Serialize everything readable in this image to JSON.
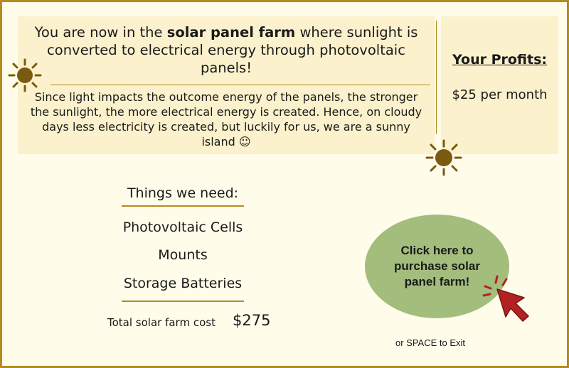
{
  "intro": {
    "prefix": "You are now in the ",
    "highlight": "solar panel farm",
    "suffix": " where sunlight is converted to electrical energy through photovoltaic panels!"
  },
  "detail": "Since light impacts the outcome energy of the panels, the stronger the sunlight, the more electrical energy is created. Hence, on cloudy days less electricity is created, but luckily for us, we are a sunny island ☺",
  "profits": {
    "title": "Your Profits:",
    "value": "$25 per month"
  },
  "needs": {
    "title": "Things we need:",
    "items": [
      "Photovoltaic Cells",
      "Mounts",
      "Storage Batteries"
    ]
  },
  "cost": {
    "label": "Total solar farm cost",
    "value": "$275"
  },
  "purchase_button": "Click here to purchase solar panel farm!",
  "exit_hint": "or SPACE to Exit",
  "colors": {
    "gold": "#b38b22",
    "panel": "#fbf1cc",
    "background": "#fffcea",
    "button_green": "#a3bd7c",
    "sun": "#7a5a10",
    "cursor_red": "#b22222"
  },
  "icons": [
    "sun-icon",
    "pointer-cursor-icon"
  ]
}
